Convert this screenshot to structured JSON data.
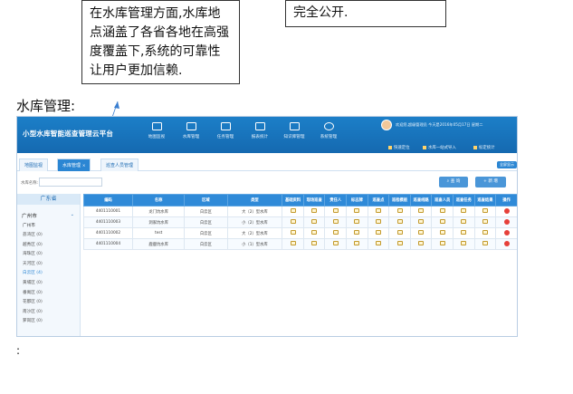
{
  "callouts": {
    "left": "在水库管理方面,水库地点涵盖了各省各地在高强度覆盖下,系统的可靠性让用户更加信赖.",
    "right": "完全公开."
  },
  "caption_title": "水库管理:",
  "footnote": ":",
  "app": {
    "title": "小型水库智能巡查管理云平台",
    "nav": [
      {
        "label": "地图监视",
        "icon": "monitor-icon"
      },
      {
        "label": "水库管理",
        "icon": "folder-icon"
      },
      {
        "label": "任务管理",
        "icon": "edit-icon"
      },
      {
        "label": "报表统计",
        "icon": "report-icon"
      },
      {
        "label": "知识库管理",
        "icon": "database-icon"
      },
      {
        "label": "系统管理",
        "icon": "gear-icon"
      }
    ],
    "welcome": "欢迎您,超级管理员  今天是2016年05月17日 星期二",
    "quick_links": [
      "快速定位",
      "水库一站式导入",
      "标定统计"
    ],
    "tabs": [
      {
        "label": "地图监视",
        "active": false
      },
      {
        "label": "水库管理",
        "active": true
      },
      {
        "label": "巡查人员管理",
        "active": false
      }
    ],
    "toggle_label": "全屏显示",
    "search_label": "水库名称:",
    "search_value": "",
    "search_button": "查 询",
    "add_button": "新 增",
    "province": "广东省",
    "city": "广州市",
    "districts": [
      {
        "label": "广州市",
        "head": true
      },
      {
        "label": "荔湾区 (0)"
      },
      {
        "label": "越秀区 (0)"
      },
      {
        "label": "海珠区 (0)"
      },
      {
        "label": "天河区 (0)"
      },
      {
        "label": "白云区 (4)",
        "selected": true
      },
      {
        "label": "黄埔区 (0)"
      },
      {
        "label": "番禺区 (0)"
      },
      {
        "label": "花都区 (0)"
      },
      {
        "label": "南沙区 (0)"
      },
      {
        "label": "萝岗区 (0)"
      }
    ],
    "columns": [
      "编码",
      "名称",
      "区域",
      "类型",
      "基础资料",
      "现场巡查",
      "责任人",
      "标志牌",
      "巡查点",
      "巡检模板",
      "巡查线路",
      "巡查人员",
      "巡查任务",
      "巡查结果",
      "操作"
    ],
    "rows": [
      [
        "4401110001",
        "龙门坑水库",
        "白云区",
        "大（2）型水库"
      ],
      [
        "4401110003",
        "洞家坑水库",
        "白云区",
        "小（2）型水库"
      ],
      [
        "4401110002",
        "test",
        "白云区",
        "大（2）型水库"
      ],
      [
        "4401110004",
        "鹿鹿坑水库",
        "白云区",
        "小（1）型水库"
      ]
    ]
  },
  "colors": {
    "header": "#1c7fc8",
    "table_header": "#2f8ad8",
    "delete": "#e6403a"
  }
}
